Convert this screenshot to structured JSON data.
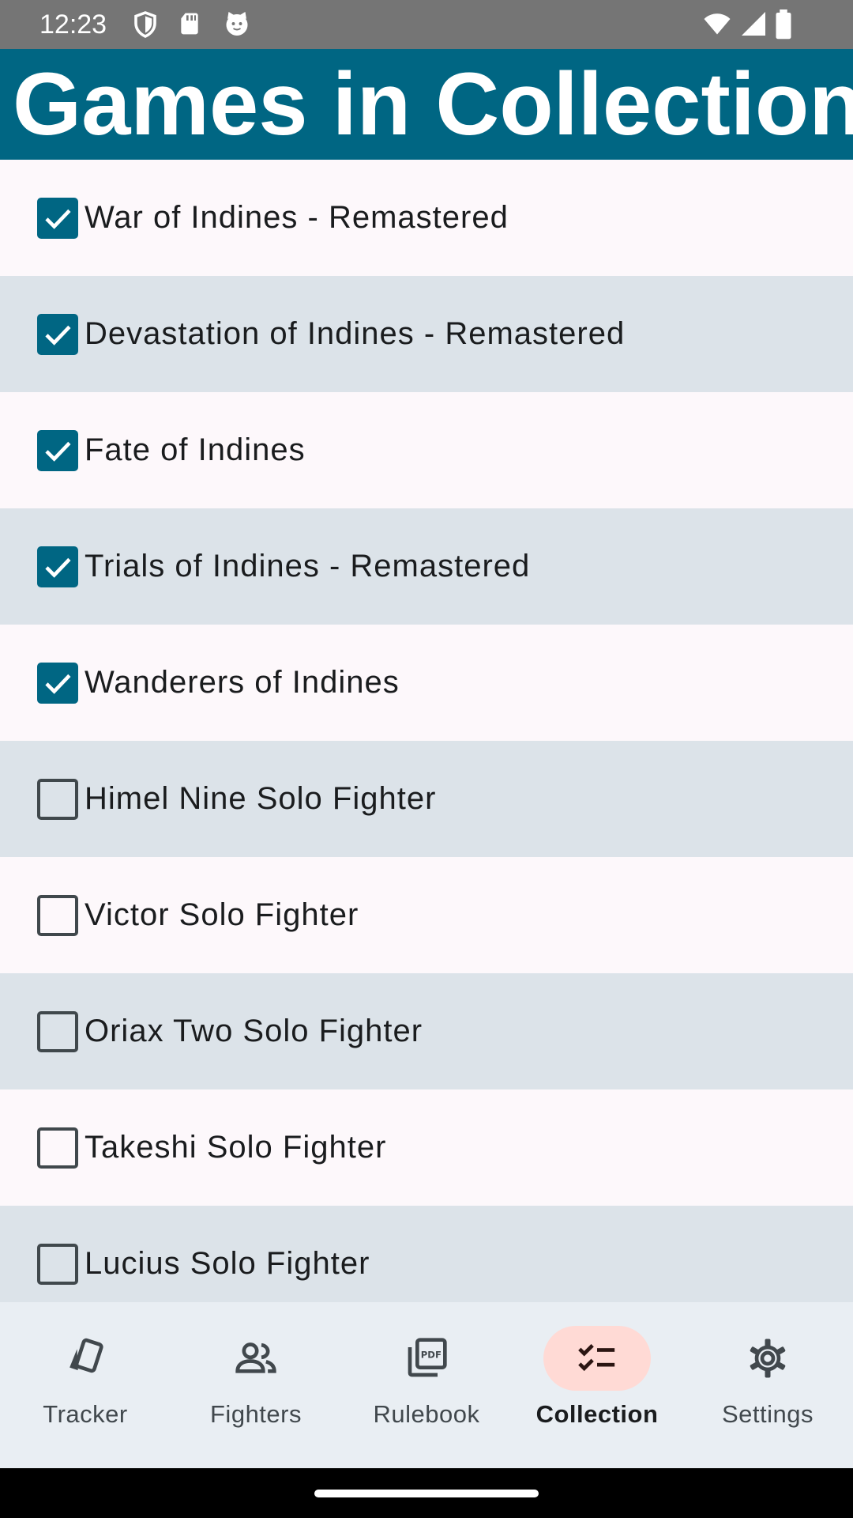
{
  "status_bar": {
    "time": "12:23",
    "icons_left": [
      "shield-icon",
      "sd-card-icon",
      "cat-face-icon"
    ],
    "icons_right": [
      "wifi-icon",
      "cell-signal-icon",
      "battery-icon"
    ]
  },
  "app_bar": {
    "title": "Games in Collection",
    "color": "#006683"
  },
  "games": [
    {
      "label": "War of Indines - Remastered",
      "checked": true
    },
    {
      "label": "Devastation of Indines - Remastered",
      "checked": true
    },
    {
      "label": "Fate of Indines",
      "checked": true
    },
    {
      "label": "Trials of Indines - Remastered",
      "checked": true
    },
    {
      "label": "Wanderers of Indines",
      "checked": true
    },
    {
      "label": "Himel Nine Solo Fighter",
      "checked": false
    },
    {
      "label": "Victor Solo Fighter",
      "checked": false
    },
    {
      "label": "Oriax Two Solo Fighter",
      "checked": false
    },
    {
      "label": "Takeshi Solo Fighter",
      "checked": false
    },
    {
      "label": "Lucius Solo Fighter",
      "checked": false
    }
  ],
  "bottom_nav": {
    "items": [
      {
        "label": "Tracker",
        "icon": "cards-icon",
        "active": false
      },
      {
        "label": "Fighters",
        "icon": "people-icon",
        "active": false
      },
      {
        "label": "Rulebook",
        "icon": "pdf-icon",
        "active": false
      },
      {
        "label": "Collection",
        "icon": "checklist-icon",
        "active": true
      },
      {
        "label": "Settings",
        "icon": "gear-icon",
        "active": false
      }
    ],
    "active_indicator_color": "#ffdad5"
  },
  "colors": {
    "checkbox_checked": "#006683",
    "row_alt": "#dce3e9",
    "row_base": "#fdf8fb"
  }
}
